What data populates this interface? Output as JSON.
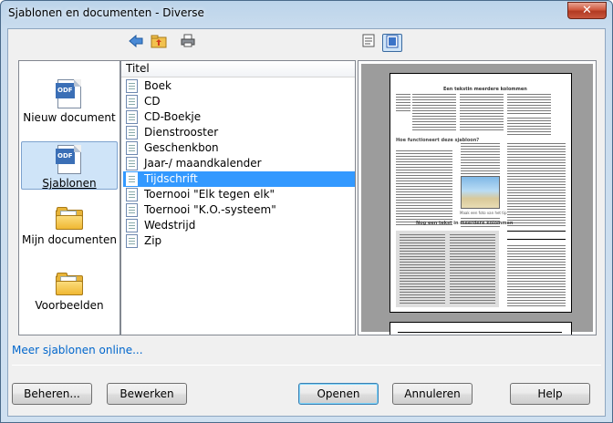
{
  "window": {
    "title": "Sjablonen en documenten - Diverse",
    "close_label": "✕"
  },
  "toolbar": {
    "back_icon": "back-arrow-icon",
    "up_icon": "folder-up-icon",
    "print_icon": "printer-icon",
    "details_icon": "document-properties-icon",
    "preview_icon": "preview-icon"
  },
  "categories": [
    {
      "label": "Nieuw document",
      "icon": "new-document-icon"
    },
    {
      "label": "Sjablonen",
      "icon": "templates-icon",
      "selected": true
    },
    {
      "label": "Mijn documenten",
      "icon": "my-documents-folder-icon"
    },
    {
      "label": "Voorbeelden",
      "icon": "examples-folder-icon"
    }
  ],
  "list": {
    "header": "Titel",
    "items": [
      "Boek",
      "CD",
      "CD-Boekje",
      "Dienstrooster",
      "Geschenkbon",
      "Jaar-/ maandkalender",
      "Tijdschrift",
      "Toernooi \"Elk tegen elk\"",
      "Toernooi \"K.O.-systeem\"",
      "Wedstrijd",
      "Zip"
    ],
    "selected": "Tijdschrift"
  },
  "preview": {
    "page_title": "Een tekstin meerdere kolommen",
    "headline1": "Hoe functioneert deze sjabloon?",
    "headline2": "Nog een tekst in meerdere kolommen",
    "caption": "Maak een foto van het tip panelen"
  },
  "link": "Meer sjablonen online...",
  "buttons": {
    "manage": "Beheren...",
    "edit": "Bewerken",
    "open": "Openen",
    "cancel": "Annuleren",
    "help": "Help"
  }
}
